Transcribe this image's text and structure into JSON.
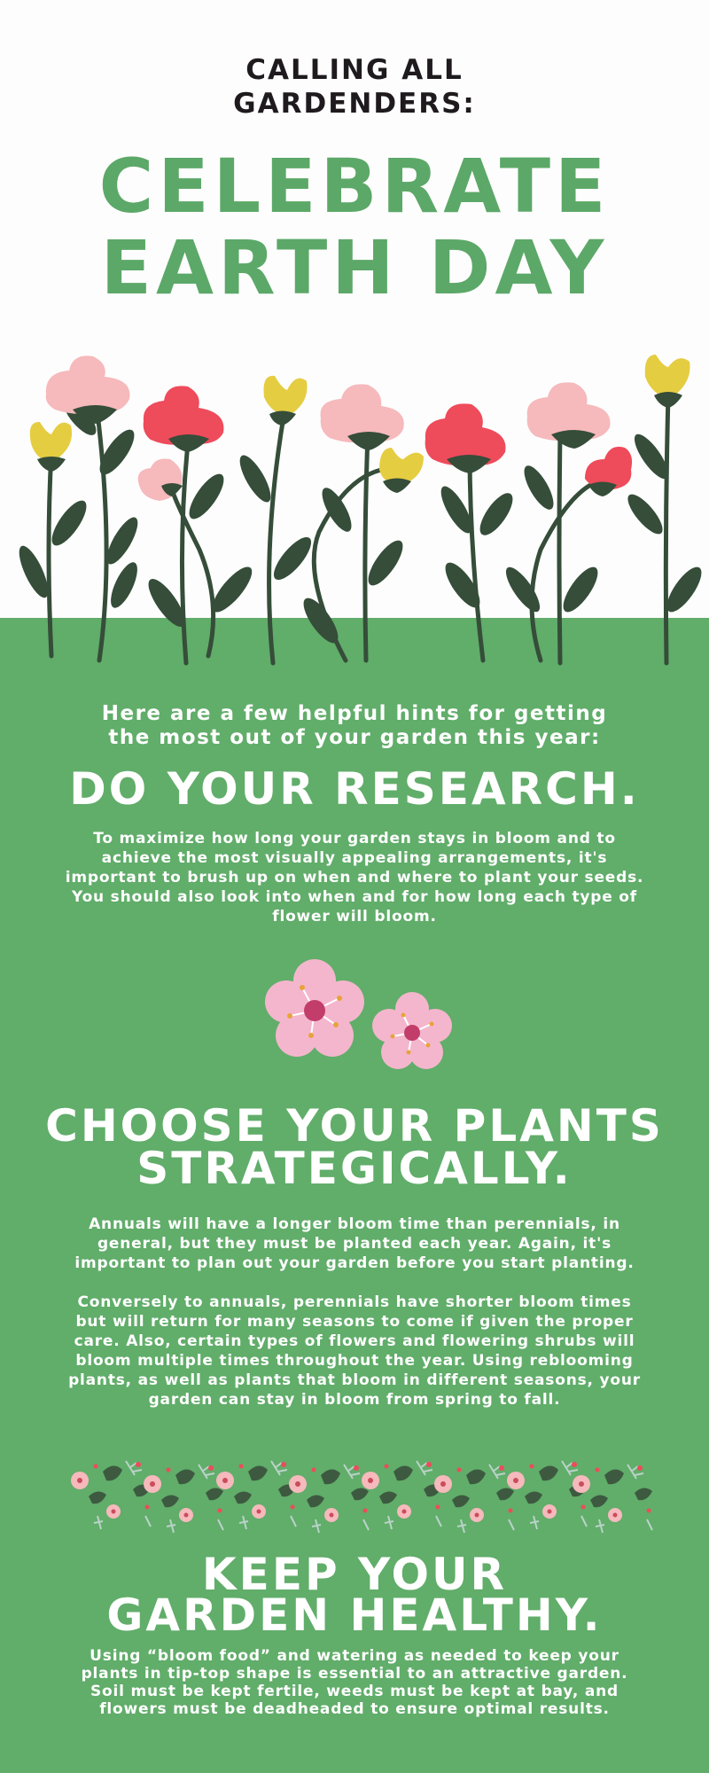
{
  "header": {
    "kicker": [
      "CALLING ALL",
      "GARDENDERS:"
    ],
    "headline": [
      "CELEBRATE",
      "EARTH DAY"
    ]
  },
  "intro": [
    "Here are a few helpful hints for getting",
    "the most out of your garden this year:"
  ],
  "sections": [
    {
      "title": [
        "DO YOUR RESEARCH."
      ],
      "paragraphs": [
        "To maximize how long your garden stays in bloom and to achieve the most visually appealing arrangements, it's important to brush up on when and where to plant your seeds. You should also look into when and for how long each type of flower will bloom."
      ]
    },
    {
      "title": [
        "CHOOSE YOUR PLANTS",
        "STRATEGICALLY."
      ],
      "paragraphs": [
        "Annuals will have a longer bloom time than perennials, in general, but they must be planted each year. Again, it's important to plan out your garden before you start planting.",
        "Conversely to annuals, perennials have shorter bloom times but will return for many seasons to come if given the proper care. Also, certain types of flowers and flowering shrubs will bloom multiple times throughout the year. Using reblooming plants, as well as plants that bloom in different seasons, your garden can stay in bloom from spring to fall."
      ]
    },
    {
      "title": [
        "KEEP YOUR",
        "GARDEN HEALTHY."
      ],
      "paragraphs": [
        "Using “bloom food” and watering as needed to keep your plants in tip-top shape is essential to an attractive garden. Soil must be kept fertile, weeds must be kept at bay, and flowers must be deadheaded to ensure optimal results."
      ]
    }
  ],
  "colors": {
    "green": "#61ad6a",
    "headline_green": "#5ca868",
    "stem": "#354d39",
    "pink": "#f6b9bc",
    "red": "#ee4b5b",
    "yellow": "#e5cd42",
    "blossom_pink": "#f4b6cd",
    "blossom_center": "#c23d6a"
  },
  "icons": [
    "flower-illustration",
    "blossom-icon",
    "floral-border"
  ]
}
